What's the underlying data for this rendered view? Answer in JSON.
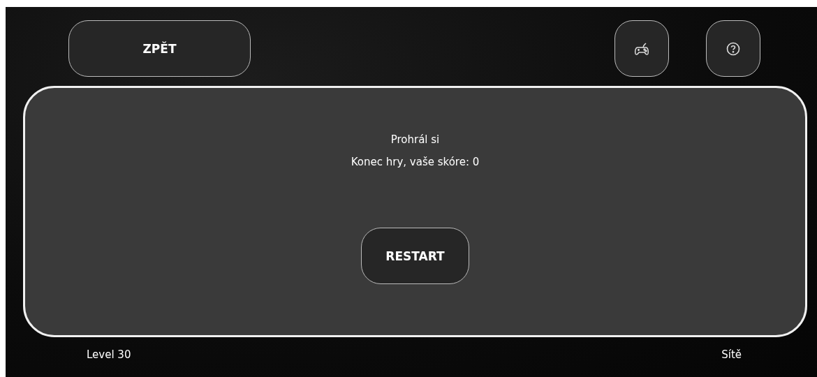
{
  "back_button": {
    "label": "ZPĚT"
  },
  "toolbar": [
    {
      "kind": "gamepad"
    },
    {
      "kind": "help"
    }
  ],
  "panel": {
    "messages": [
      "Prohrál si",
      "Konec hry, vaše skóre: 0"
    ],
    "restart_button": {
      "label": "RESTART"
    }
  },
  "footer": {
    "level": "Level 30",
    "category": "Sítě"
  }
}
